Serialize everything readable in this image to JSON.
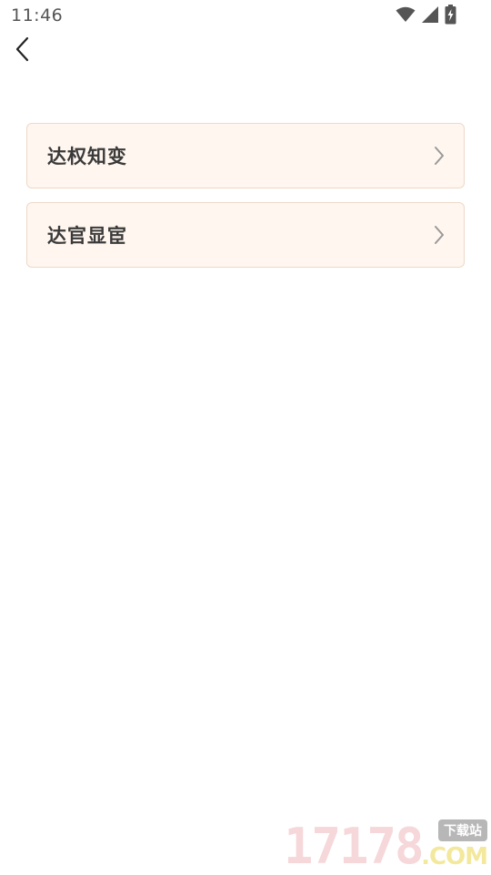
{
  "status_bar": {
    "time": "11:46",
    "icons": [
      "wifi-icon",
      "signal-icon",
      "battery-charging-icon"
    ],
    "icon_color": "#555555"
  },
  "nav": {
    "back_icon": "chevron-left-icon"
  },
  "menu": {
    "items": [
      {
        "label": "达权知变"
      },
      {
        "label": "达官显宦"
      }
    ],
    "item_background": "#fff6ef",
    "item_border": "#eed9c8",
    "chevron_icon": "chevron-right-icon"
  },
  "watermark": {
    "number": "17178",
    "domain": ".COM",
    "badge": "下载站"
  }
}
